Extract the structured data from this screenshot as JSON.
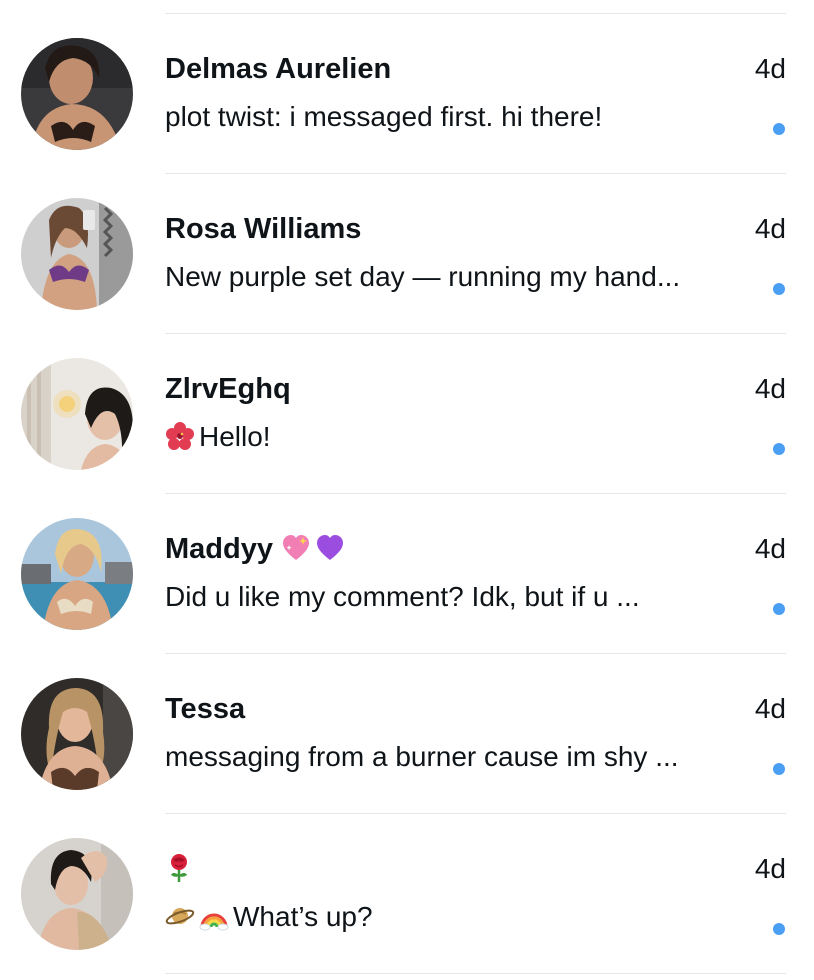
{
  "accent_color": "#4a9ff5",
  "conversations": [
    {
      "name": "Delmas Aurelien",
      "name_suffix_icons": [],
      "preview": "plot twist: i messaged first. hi there!",
      "preview_prefix_icons": [],
      "time": "4d",
      "unread": true,
      "avatar": "avatar-photo-woman-dark-hair"
    },
    {
      "name": "Rosa Williams",
      "name_suffix_icons": [],
      "preview": "New purple set day — running my hand...",
      "preview_prefix_icons": [],
      "time": "4d",
      "unread": true,
      "avatar": "avatar-photo-woman-mirror-selfie"
    },
    {
      "name": "ZlrvEghq",
      "name_suffix_icons": [],
      "preview": "Hello!",
      "preview_prefix_icons": [
        "hibiscus-emoji"
      ],
      "time": "4d",
      "unread": true,
      "avatar": "avatar-photo-woman-indoor"
    },
    {
      "name": "Maddyy",
      "name_suffix_icons": [
        "sparkling-heart-emoji",
        "purple-heart-emoji"
      ],
      "preview": "Did u like my comment? Idk, but if u ...",
      "preview_prefix_icons": [],
      "time": "4d",
      "unread": true,
      "avatar": "avatar-photo-woman-poolside"
    },
    {
      "name": "Tessa",
      "name_suffix_icons": [],
      "preview": "messaging from a burner cause im shy ...",
      "preview_prefix_icons": [],
      "time": "4d",
      "unread": true,
      "avatar": "avatar-photo-woman-wavy-hair"
    },
    {
      "name": "",
      "name_suffix_icons": [
        "rose-emoji"
      ],
      "preview": "What’s up?",
      "preview_prefix_icons": [
        "ringed-planet-emoji",
        "rainbow-emoji"
      ],
      "time": "4d",
      "unread": true,
      "avatar": "avatar-photo-woman-beige-top"
    }
  ]
}
